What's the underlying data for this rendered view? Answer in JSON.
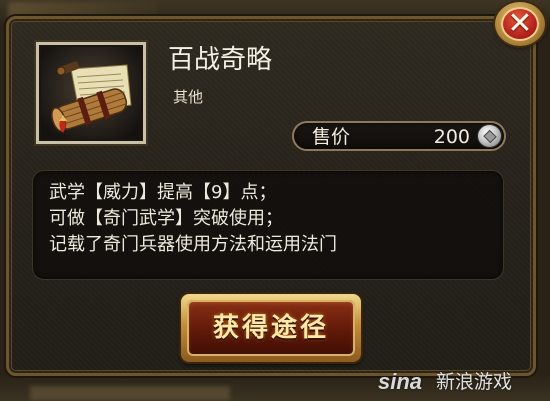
{
  "item": {
    "name": "百战奇略",
    "type": "其他",
    "icon": "scroll-bundle-icon"
  },
  "price": {
    "label": "售价",
    "value": "200",
    "currency_icon": "silver-coin-icon"
  },
  "description": {
    "lines": [
      "武学【威力】提高【9】点；",
      "可做【奇门武学】突破使用；",
      "记载了奇门兵器使用方法和运用法门"
    ]
  },
  "buttons": {
    "obtain_label": "获得途径",
    "close_icon": "close-icon"
  },
  "watermark": {
    "brand": "sina",
    "text": "新浪游戏"
  },
  "colors": {
    "accent_gold": "#c28e3b",
    "close_red": "#b3201a",
    "panel_bg": "#2f2a20"
  }
}
